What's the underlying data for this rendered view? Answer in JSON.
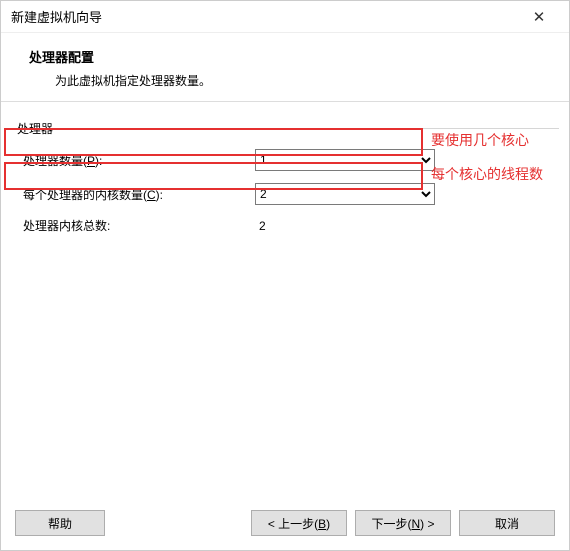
{
  "titlebar": {
    "title": "新建虚拟机向导"
  },
  "header": {
    "title": "处理器配置",
    "subtitle": "为此虚拟机指定处理器数量。"
  },
  "group": {
    "legend": "处理器",
    "row1": {
      "label_pre": "处理器数量(",
      "label_key": "P",
      "label_post": "):",
      "value": "1"
    },
    "row2": {
      "label_pre": "每个处理器的内核数量(",
      "label_key": "C",
      "label_post": "):",
      "value": "2"
    },
    "row3": {
      "label": "处理器内核总数:",
      "value": "2"
    }
  },
  "annotations": {
    "a1": "要使用几个核心",
    "a2": "每个核心的线程数"
  },
  "buttons": {
    "help": "帮助",
    "back_pre": "< 上一步(",
    "back_key": "B",
    "back_post": ")",
    "next_pre": "下一步(",
    "next_key": "N",
    "next_post": ") >",
    "cancel": "取消"
  }
}
